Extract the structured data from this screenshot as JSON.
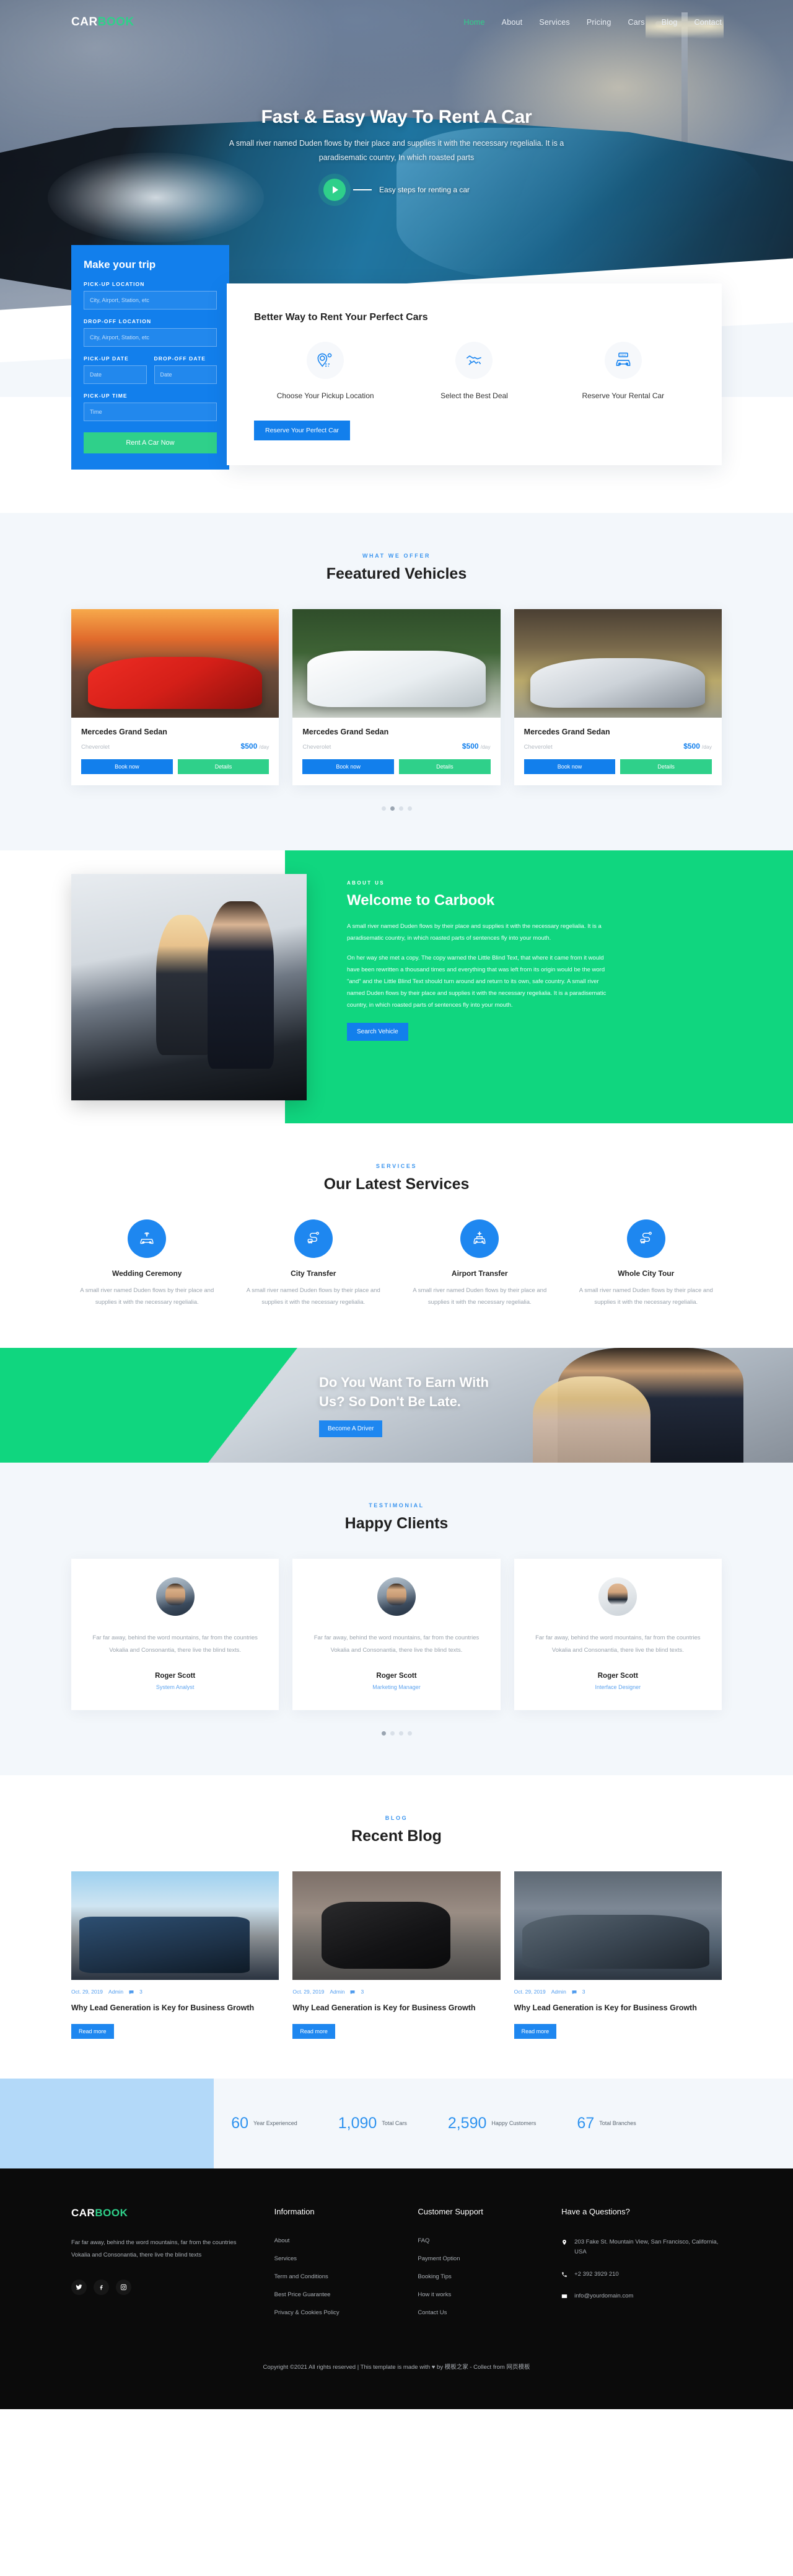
{
  "brand": {
    "first": "CAR",
    "second": "BOOK"
  },
  "colors": {
    "primary_blue": "#127fec",
    "accent_green": "#2fd08a",
    "about_green": "#10d67f",
    "light_bg": "#f3f7fb",
    "footer_bg": "#0b0b0b"
  },
  "nav": {
    "items": [
      {
        "label": "Home",
        "active": true
      },
      {
        "label": "About",
        "active": false
      },
      {
        "label": "Services",
        "active": false
      },
      {
        "label": "Pricing",
        "active": false
      },
      {
        "label": "Cars",
        "active": false
      },
      {
        "label": "Blog",
        "active": false
      },
      {
        "label": "Contact",
        "active": false
      }
    ]
  },
  "hero": {
    "title": "Fast & Easy Way To Rent A Car",
    "subtitle": "A small river named Duden flows by their place and supplies it with the necessary regelialia. It is a paradisematic country, In which roasted parts",
    "play_label": "Easy steps for renting a car"
  },
  "trip_form": {
    "title": "Make your trip",
    "pickup_location_label": "PICK-UP LOCATION",
    "pickup_location_placeholder": "City, Airport, Station, etc",
    "dropoff_location_label": "DROP-OFF LOCATION",
    "dropoff_location_placeholder": "City, Airport, Station, etc",
    "pickup_date_label": "PICK-UP DATE",
    "pickup_date_placeholder": "Date",
    "dropoff_date_label": "DROP-OFF DATE",
    "dropoff_date_placeholder": "Date",
    "pickup_time_label": "PICK-UP TIME",
    "pickup_time_placeholder": "Time",
    "submit_label": "Rent A Car Now"
  },
  "better": {
    "title": "Better Way to Rent Your Perfect Cars",
    "steps": [
      {
        "icon": "location-pin-route-icon",
        "label": "Choose Your Pickup Location"
      },
      {
        "icon": "handshake-icon",
        "label": "Select the Best Deal"
      },
      {
        "icon": "rent-car-icon",
        "label": "Reserve Your Rental Car"
      }
    ],
    "button_label": "Reserve Your Perfect Car"
  },
  "vehicles_section": {
    "eyebrow": "WHAT WE OFFER",
    "title": "Feeatured Vehicles",
    "cards": [
      {
        "name": "Mercedes Grand Sedan",
        "brand": "Cheverolet",
        "price": "$500",
        "unit": "/day",
        "book_label": "Book now",
        "details_label": "Details"
      },
      {
        "name": "Mercedes Grand Sedan",
        "brand": "Cheverolet",
        "price": "$500",
        "unit": "/day",
        "book_label": "Book now",
        "details_label": "Details"
      },
      {
        "name": "Mercedes Grand Sedan",
        "brand": "Cheverolet",
        "price": "$500",
        "unit": "/day",
        "book_label": "Book now",
        "details_label": "Details"
      }
    ],
    "dots": [
      false,
      true,
      false,
      false
    ]
  },
  "about": {
    "eyebrow": "ABOUT US",
    "title": "Welcome to Carbook",
    "paragraph1": "A small river named Duden flows by their place and supplies it with the necessary regelialia. It is a paradisematic country, in which roasted parts of sentences fly into your mouth.",
    "paragraph2": "On her way she met a copy. The copy warned the Little Blind Text, that where it came from it would have been rewritten a thousand times and everything that was left from its origin would be the word \"and\" and the Little Blind Text should turn around and return to its own, safe country. A small river named Duden flows by their place and supplies it with the necessary regelialia. It is a paradisematic country, in which roasted parts of sentences fly into your mouth.",
    "button_label": "Search Vehicle"
  },
  "services_section": {
    "eyebrow": "SERVICES",
    "title": "Our Latest Services",
    "items": [
      {
        "icon": "wedding-car-icon",
        "name": "Wedding Ceremony",
        "desc": "A small river named Duden flows by their place and supplies it with the necessary regelialia."
      },
      {
        "icon": "city-route-icon",
        "name": "City Transfer",
        "desc": "A small river named Duden flows by their place and supplies it with the necessary regelialia."
      },
      {
        "icon": "airport-car-icon",
        "name": "Airport Transfer",
        "desc": "A small river named Duden flows by their place and supplies it with the necessary regelialia."
      },
      {
        "icon": "city-route-icon",
        "name": "Whole City Tour",
        "desc": "A small river named Duden flows by their place and supplies it with the necessary regelialia."
      }
    ]
  },
  "cta": {
    "title": "Do You Want To Earn With Us? So Don't Be Late.",
    "button_label": "Become A Driver"
  },
  "testimonials_section": {
    "eyebrow": "TESTIMONIAL",
    "title": "Happy Clients",
    "items": [
      {
        "quote": "Far far away, behind the word mountains, far from the countries Vokalia and Consonantia, there live the blind texts.",
        "name": "Roger Scott",
        "role": "System Analyst"
      },
      {
        "quote": "Far far away, behind the word mountains, far from the countries Vokalia and Consonantia, there live the blind texts.",
        "name": "Roger Scott",
        "role": "Marketing Manager"
      },
      {
        "quote": "Far far away, behind the word mountains, far from the countries Vokalia and Consonantia, there live the blind texts.",
        "name": "Roger Scott",
        "role": "Interface Designer"
      }
    ],
    "dots": [
      true,
      false,
      false,
      false
    ]
  },
  "blog_section": {
    "eyebrow": "BLOG",
    "title": "Recent Blog",
    "posts": [
      {
        "date": "Oct. 29, 2019",
        "author": "Admin",
        "comments": "3",
        "title": "Why Lead Generation is Key for Business Growth",
        "button_label": "Read more"
      },
      {
        "date": "Oct. 29, 2019",
        "author": "Admin",
        "comments": "3",
        "title": "Why Lead Generation is Key for Business Growth",
        "button_label": "Read more"
      },
      {
        "date": "Oct. 29, 2019",
        "author": "Admin",
        "comments": "3",
        "title": "Why Lead Generation is Key for Business Growth",
        "button_label": "Read more"
      }
    ]
  },
  "stats": [
    {
      "number": "60",
      "label": "Year Experienced"
    },
    {
      "number": "1,090",
      "label": "Total Cars"
    },
    {
      "number": "2,590",
      "label": "Happy Customers"
    },
    {
      "number": "67",
      "label": "Total Branches"
    }
  ],
  "footer": {
    "description": "Far far away, behind the word mountains, far from the countries Vokalia and Consonantia, there live the blind texts",
    "social": [
      {
        "icon": "twitter-icon"
      },
      {
        "icon": "facebook-icon"
      },
      {
        "icon": "instagram-icon"
      }
    ],
    "information": {
      "heading": "Information",
      "links": [
        "About",
        "Services",
        "Term and Conditions",
        "Best Price Guarantee",
        "Privacy & Cookies Policy"
      ]
    },
    "support": {
      "heading": "Customer Support",
      "links": [
        "FAQ",
        "Payment Option",
        "Booking Tips",
        "How it works",
        "Contact Us"
      ]
    },
    "questions": {
      "heading": "Have a Questions?",
      "address": "203 Fake St. Mountain View, San Francisco, California, USA",
      "phone": "+2 392 3929 210",
      "email": "info@yourdomain.com"
    },
    "copyright": "Copyright ©2021 All rights reserved | This template is made with ♥ by 模板之家 - Collect from 网页模板"
  }
}
